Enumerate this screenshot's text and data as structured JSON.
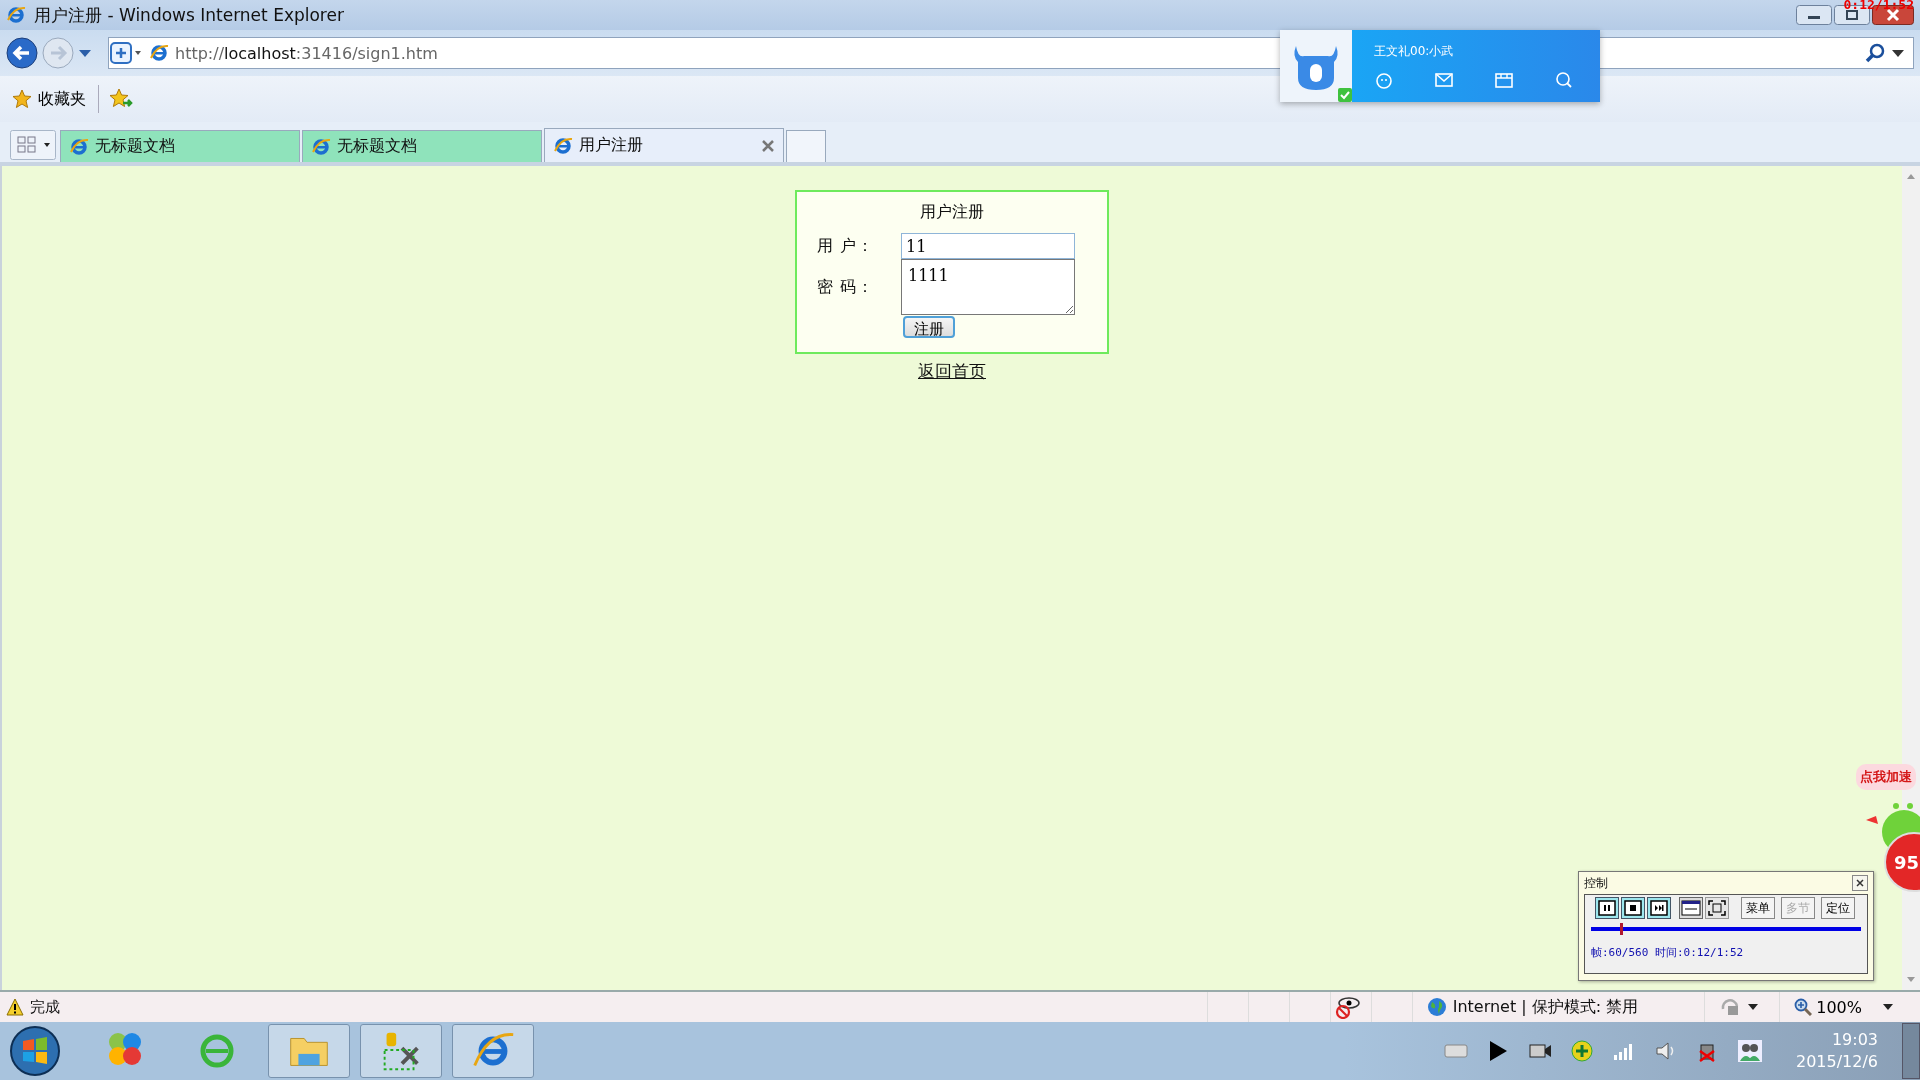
{
  "window": {
    "title": "用户注册 - Windows Internet Explorer",
    "recording_time": "0:12/1:52"
  },
  "address_bar": {
    "scheme": "http://",
    "host": "localhost",
    "rest": ":31416/sign1.htm"
  },
  "favorites_bar": {
    "label": "收藏夹"
  },
  "tabs": [
    {
      "label": "无标题文档",
      "selected": false
    },
    {
      "label": "无标题文档",
      "selected": false
    },
    {
      "label": "用户注册",
      "selected": true
    }
  ],
  "notification": {
    "name": "王文礼00:小武",
    "online": true
  },
  "form": {
    "title": "用户注册",
    "fields": [
      {
        "label": "用 户：",
        "value": "11",
        "kind": "input"
      },
      {
        "label": "密 码：",
        "value": "1111",
        "kind": "textarea"
      }
    ],
    "button": "注册",
    "link": "返回首页"
  },
  "mascot": {
    "bubble": "点我加速",
    "badge": "95"
  },
  "player_panel": {
    "title": "控制",
    "buttons": [
      {
        "label": "菜单",
        "disabled": false
      },
      {
        "label": "多节",
        "disabled": true
      },
      {
        "label": "定位",
        "disabled": false
      }
    ],
    "level": 0.107,
    "info": "帧:60/560 时间:0:12/1:52"
  },
  "status_bar": {
    "text": "完成",
    "zone": "Internet | 保护模式: 禁用",
    "zoom": "100%"
  },
  "taskbar": {
    "time": "19:03",
    "date": "2015/12/6"
  }
}
